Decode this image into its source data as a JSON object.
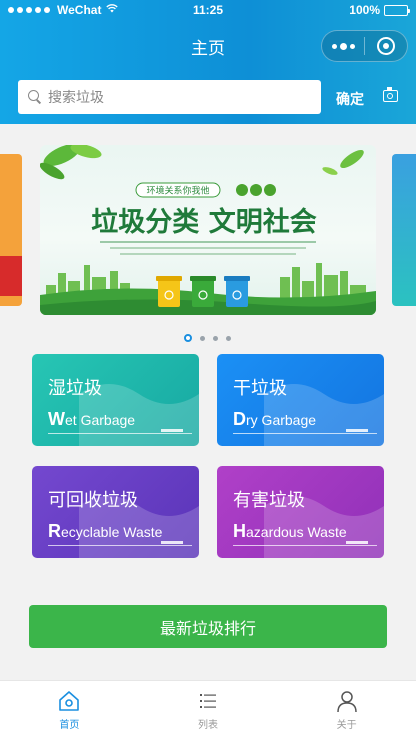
{
  "status_bar": {
    "carrier": "WeChat",
    "time": "11:25",
    "battery": "100%"
  },
  "nav": {
    "title": "主页"
  },
  "search": {
    "placeholder": "搜索垃圾",
    "confirm_label": "确定"
  },
  "banner": {
    "slogan": "垃圾分类 文明社会",
    "badge": "环境关系你我他",
    "slide_count": 4,
    "active_slide": 1
  },
  "categories": [
    {
      "cn": "湿垃圾",
      "initial": "W",
      "en_rest": "et Garbage",
      "color": "#21bfad"
    },
    {
      "cn": "干垃圾",
      "initial": "D",
      "en_rest": "ry Garbage",
      "color": "#1b86f0"
    },
    {
      "cn": "可回收垃圾",
      "initial": "R",
      "en_rest": "ecyclable Waste",
      "color": "#6a3fc7"
    },
    {
      "cn": "有害垃圾",
      "initial": "H",
      "en_rest": "azardous Waste",
      "color": "#a33bc4"
    }
  ],
  "rank_button": "最新垃圾排行",
  "tabbar": [
    {
      "label": "首页",
      "icon": "home-icon",
      "active": true
    },
    {
      "label": "列表",
      "icon": "list-icon",
      "active": false
    },
    {
      "label": "关于",
      "icon": "person-icon",
      "active": false
    }
  ],
  "colors": {
    "header": "#0e8fd6",
    "accent": "#1a8fe0",
    "button": "#3bb54a"
  }
}
